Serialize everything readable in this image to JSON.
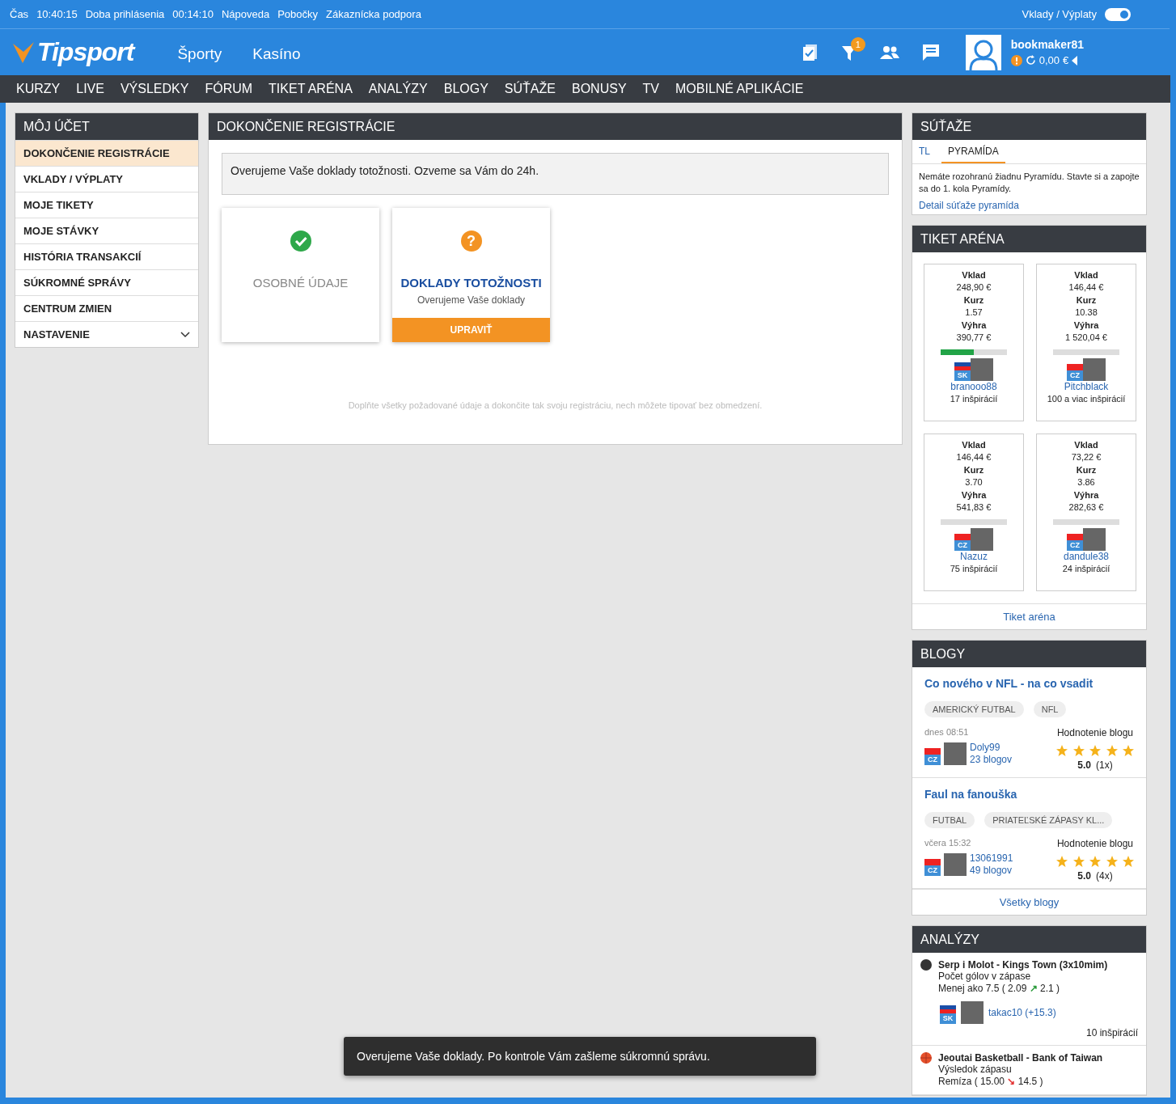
{
  "top_bar": {
    "items": [
      {
        "label": "Čas",
        "value": "10:40:15"
      },
      {
        "label": "Doba prihlásenia",
        "value": "00:14:10"
      }
    ],
    "links": [
      "Nápoveda",
      "Pobočky",
      "Zákaznícka podpora"
    ],
    "right_link": "Vklady / Výplaty",
    "toggle": {
      "on": true
    }
  },
  "header": {
    "logo": "Tipsport",
    "menu": [
      "Športy",
      "Kasíno"
    ],
    "notification_count": "1",
    "username": "bookmaker81",
    "balance": "0,00",
    "currency": "€"
  },
  "nav": [
    "KURZY",
    "LIVE",
    "VÝSLEDKY",
    "FÓRUM",
    "TIKET ARÉNA",
    "ANALÝZY",
    "BLOGY",
    "SÚŤAŽE",
    "BONUSY",
    "TV",
    "MOBILNÉ APLIKÁCIE"
  ],
  "sidebar": {
    "title": "MÔJ ÚČET",
    "items": [
      {
        "label": "DOKONČENIE REGISTRÁCIE",
        "selected": true,
        "kind": "link"
      },
      {
        "label": "VKLADY / VÝPLATY",
        "selected": false,
        "kind": "link"
      },
      {
        "label": "MOJE TIKETY",
        "selected": false,
        "kind": "link"
      },
      {
        "label": "MOJE STÁVKY",
        "selected": false,
        "kind": "link"
      },
      {
        "label": "HISTÓRIA TRANSAKCIÍ",
        "selected": false,
        "kind": "link"
      },
      {
        "label": "SÚKROMNÉ SPRÁVY",
        "selected": false,
        "kind": "link"
      },
      {
        "label": "CENTRUM ZMIEN",
        "selected": false,
        "kind": "link"
      },
      {
        "label": "NASTAVENIE",
        "selected": false,
        "kind": "group"
      }
    ]
  },
  "main": {
    "title": "DOKONČENIE REGISTRÁCIE",
    "notice": "Overujeme Vaše doklady totožnosti. Ozveme sa Vám do 24h.",
    "steps": [
      {
        "kind": "done",
        "title": "OSOBNÉ ÚDAJE"
      },
      {
        "kind": "pending",
        "icon": "?",
        "title": "DOKLADY TOTOŽNOSTI",
        "subtitle": "Overujeme Vaše doklady",
        "button": "UPRAVIŤ"
      }
    ],
    "footer": "Doplňte všetky požadované údaje a dokončite tak svoju registráciu, nech môžete tipovať bez obmedzení."
  },
  "contests": {
    "title": "SÚŤAŽE",
    "tabs": [
      {
        "label": "TL",
        "selected": false
      },
      {
        "label": "PYRAMÍDA",
        "selected": true
      }
    ],
    "text": "Nemáte rozohranú žiadnu Pyramídu. Stavte si a zapojte sa do 1. kola Pyramídy.",
    "link": "Detail súťaže pyramída"
  },
  "ticket_arena": {
    "title": "TIKET ARÉNA",
    "tickets": [
      {
        "stake_label": "Vklad",
        "stake": "248,90 €",
        "odds_label": "Kurz",
        "odds": "1.57",
        "win_label": "Výhra",
        "win": "390,77 €",
        "level": 0.5,
        "flag": "SK",
        "user": "branooo88",
        "inspirations": "17 inšpirácií"
      },
      {
        "stake_label": "Vklad",
        "stake": "146,44 €",
        "odds_label": "Kurz",
        "odds": "10.38",
        "win_label": "Výhra",
        "win": "1 520,04 €",
        "level": 0,
        "flag": "CZ",
        "user": "Pitchblack",
        "inspirations": "100 a viac inšpirácií"
      },
      {
        "stake_label": "Vklad",
        "stake": "146,44 €",
        "odds_label": "Kurz",
        "odds": "3.70",
        "win_label": "Výhra",
        "win": "541,83 €",
        "level": 0,
        "flag": "CZ",
        "user": "Nazuz",
        "inspirations": "75 inšpirácií"
      },
      {
        "stake_label": "Vklad",
        "stake": "73,22 €",
        "odds_label": "Kurz",
        "odds": "3.86",
        "win_label": "Výhra",
        "win": "282,63 €",
        "level": 0,
        "flag": "CZ",
        "user": "dandule38",
        "inspirations": "24 inšpirácií"
      }
    ],
    "link": "Tiket aréna"
  },
  "blogs": {
    "title": "BLOGY",
    "posts": [
      {
        "title": "Co nového v NFL - na co vsadit",
        "tags": [
          "AMERICKÝ FUTBAL",
          "NFL"
        ],
        "time": "dnes 08:51",
        "rating_label": "Hodnotenie blogu",
        "flag": "CZ",
        "author": "Doly99",
        "count": "23 blogov",
        "stars": 5,
        "score": "5.0",
        "votes": "(1x)"
      },
      {
        "title": "Faul na fanouška",
        "tags": [
          "FUTBAL",
          "PRIATEĽSKÉ ZÁPASY KL..."
        ],
        "time": "včera 15:32",
        "rating_label": "Hodnotenie blogu",
        "flag": "CZ",
        "author": "13061991",
        "count": "49 blogov",
        "stars": 5,
        "score": "5.0",
        "votes": "(4x)"
      }
    ],
    "link": "Všetky blogy"
  },
  "analyses": {
    "title": "ANALÝZY",
    "items": [
      {
        "kind": "hockey",
        "match": "Serp i Molot - Kings Town (3x10mim)",
        "market": "Počet gólov v zápase",
        "pick": "Menej ako 7.5 ( 2.09",
        "change": {
          "arrow": "↗",
          "color": "#2a9a3a"
        },
        "new_odds": "2.1 )",
        "flag": "SK",
        "user": "takac10 (+15.3)",
        "inspirations": "10 inšpirácií"
      },
      {
        "kind": "basketball",
        "match": "Jeoutai Basketball - Bank of Taiwan",
        "market": "Výsledok zápasu",
        "pick": "Remíza ( 15.00",
        "change": {
          "arrow": "↘",
          "color": "#e33333"
        },
        "new_odds": "14.5 )"
      }
    ]
  },
  "toast": "Overujeme Vaše doklady. Po kontrole Vám zašleme súkromnú správu."
}
